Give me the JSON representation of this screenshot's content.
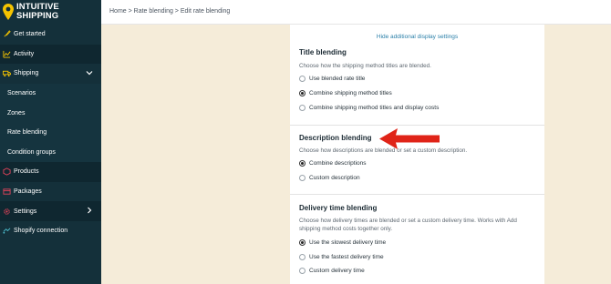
{
  "brand": {
    "line1": "INTUITIVE",
    "line2": "SHIPPING",
    "pin_color": "#f5c400"
  },
  "breadcrumb": "Home > Rate blending > Edit rate blending",
  "sidebar": {
    "items": [
      {
        "label": "Get started",
        "icon": "rocket-icon"
      },
      {
        "label": "Activity",
        "icon": "activity-chart-icon"
      },
      {
        "label": "Shipping",
        "icon": "shipping-truck-icon"
      },
      {
        "label": "Scenarios"
      },
      {
        "label": "Zones"
      },
      {
        "label": "Rate blending"
      },
      {
        "label": "Condition groups"
      },
      {
        "label": "Products",
        "icon": "product-icon"
      },
      {
        "label": "Packages",
        "icon": "package-icon"
      },
      {
        "label": "Settings",
        "icon": "gear-icon"
      },
      {
        "label": "Shopify connection",
        "icon": "connection-icon"
      }
    ]
  },
  "main": {
    "hide_link": "Hide additional display settings",
    "title_blending": {
      "title": "Title blending",
      "desc": "Choose how the shipping method titles are blended.",
      "options": [
        "Use blended rate title",
        "Combine shipping method titles",
        "Combine shipping method titles and display costs"
      ],
      "selected": 1
    },
    "description_blending": {
      "title": "Description blending",
      "desc": "Choose how descriptions are blended or set a custom description.",
      "options": [
        "Combine descriptions",
        "Custom description"
      ],
      "selected": 0
    },
    "delivery_blending": {
      "title": "Delivery time blending",
      "desc_line1": "Choose how delivery times are blended or set a custom delivery time. Works with Add",
      "desc_line2": "shipping method costs together only.",
      "options": [
        "Use the slowest delivery time",
        "Use the fastest delivery time",
        "Custom delivery time"
      ],
      "selected": 0
    }
  },
  "colors": {
    "sidebar": "#14303a",
    "page_bg": "#f5ecd9",
    "link": "#2a7fa8",
    "arrow": "#e02418"
  }
}
